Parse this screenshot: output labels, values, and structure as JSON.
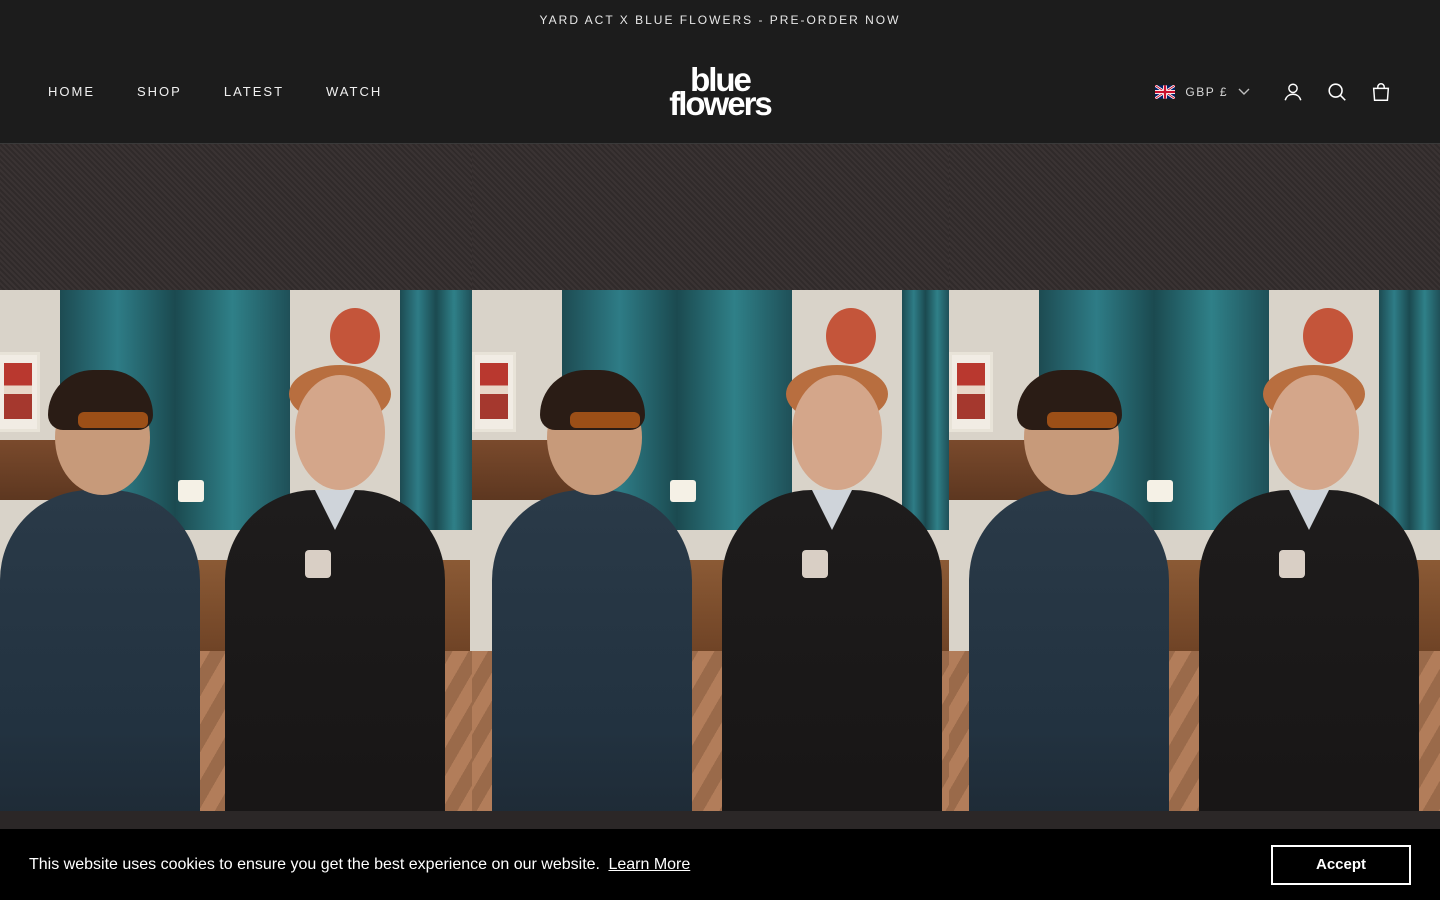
{
  "announcement": {
    "text": "YARD ACT X BLUE FLOWERS - PRE-ORDER NOW"
  },
  "nav": {
    "items": [
      {
        "label": "HOME"
      },
      {
        "label": "SHOP"
      },
      {
        "label": "LATEST"
      },
      {
        "label": "WATCH"
      }
    ]
  },
  "logo": {
    "line1": "blue",
    "line2": "flowers"
  },
  "header_right": {
    "currency_label": "GBP £",
    "flag_icon": "uk-flag-icon",
    "icons": [
      "chevron-down-icon",
      "account-icon",
      "search-icon",
      "cart-icon"
    ]
  },
  "cookie": {
    "message": "This website uses cookies to ensure you get the best experience on our website.",
    "learn_more": "Learn More",
    "accept": "Accept"
  },
  "colors": {
    "background": "#1c1c1c",
    "cookie_background": "#000000",
    "text": "#ffffff"
  }
}
